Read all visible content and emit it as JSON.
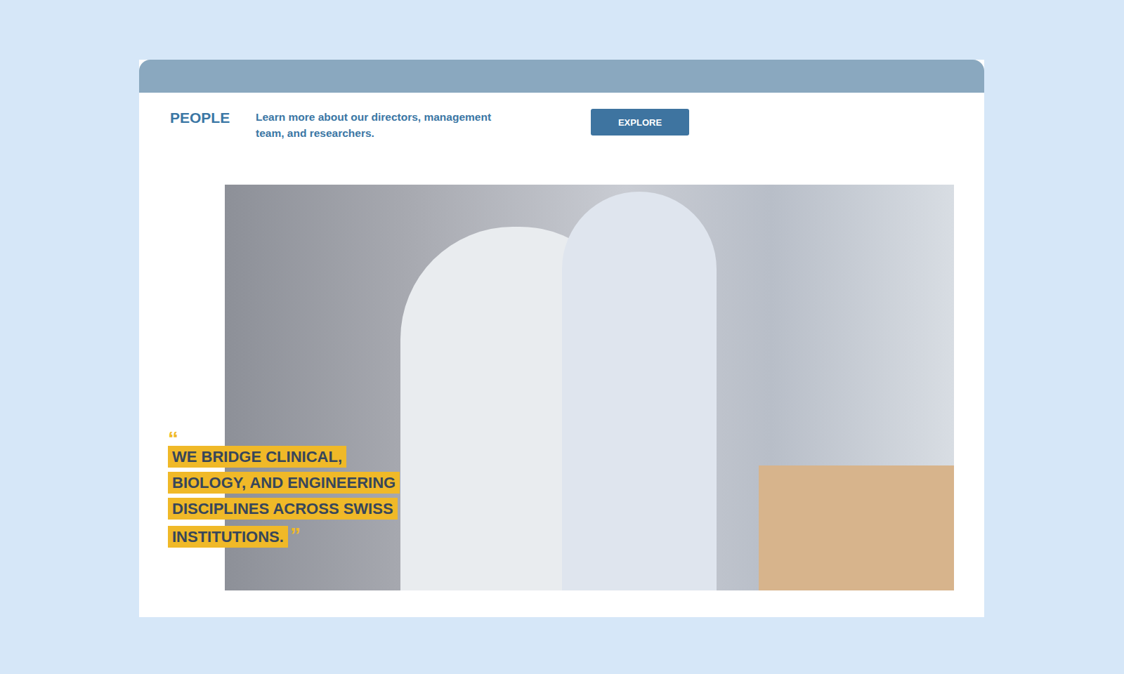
{
  "section": {
    "title": "PEOPLE",
    "description": "Learn more about our directors, management team, and researchers.",
    "button": "EXPLORE"
  },
  "quote": {
    "open_mark": "“",
    "text": "WE BRIDGE CLINICAL, BIOLOGY, AND ENGINEERING DISCIPLINES ACROSS SWISS INSTITUTIONS.",
    "close_mark": "”"
  }
}
